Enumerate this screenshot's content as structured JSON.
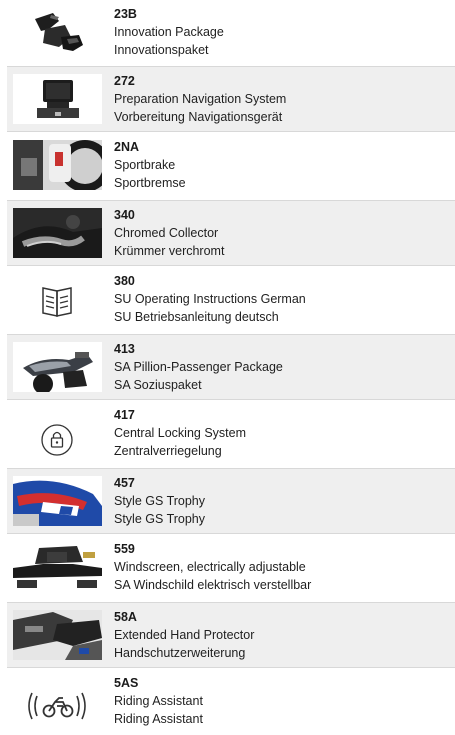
{
  "items": [
    {
      "code": "23B",
      "line1": "Innovation Package",
      "line2": "Innovationspaket",
      "thumbnail": "innovation-package-photo"
    },
    {
      "code": "272",
      "line1": "Preparation Navigation System",
      "line2": "Vorbereitung Navigationsgerät",
      "thumbnail": "navigation-device-photo"
    },
    {
      "code": "2NA",
      "line1": "Sportbrake",
      "line2": "Sportbremse",
      "thumbnail": "brake-caliper-photo"
    },
    {
      "code": "340",
      "line1": "Chromed Collector",
      "line2": "Krümmer verchromt",
      "thumbnail": "exhaust-collector-photo"
    },
    {
      "code": "380",
      "line1": "SU Operating Instructions German",
      "line2": "SU Betriebsanleitung deutsch",
      "thumbnail": "open-book-icon"
    },
    {
      "code": "413",
      "line1": "SA Pillion-Passenger Package",
      "line2": "SA Soziuspaket",
      "thumbnail": "pillion-seat-photo"
    },
    {
      "code": "417",
      "line1": "Central Locking System",
      "line2": "Zentralverriegelung",
      "thumbnail": "padlock-icon"
    },
    {
      "code": "457",
      "line1": "Style GS Trophy",
      "line2": "Style GS Trophy",
      "thumbnail": "gs-trophy-style-photo"
    },
    {
      "code": "559",
      "line1": "Windscreen, electrically adjustable",
      "line2": "SA Windschild elektrisch verstellbar",
      "thumbnail": "windscreen-cockpit-photo"
    },
    {
      "code": "58A",
      "line1": "Extended Hand Protector",
      "line2": "Handschutzerweiterung",
      "thumbnail": "hand-protector-photo"
    },
    {
      "code": "5AS",
      "line1": "Riding Assistant",
      "line2": "Riding Assistant",
      "thumbnail": "motorcycle-radar-icon"
    }
  ]
}
